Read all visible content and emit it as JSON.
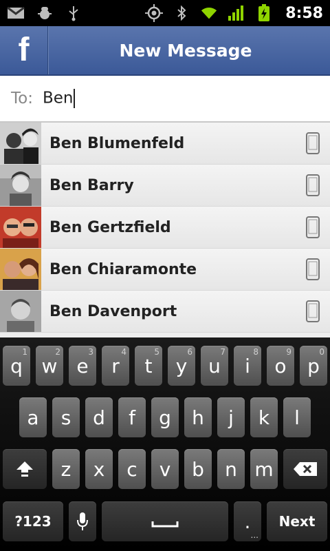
{
  "status_bar": {
    "time": "8:58",
    "icons_left": [
      "gmail-icon",
      "debug-icon",
      "usb-icon"
    ],
    "icons_right": [
      "gps-icon",
      "bluetooth-icon",
      "wifi-icon",
      "signal-icon",
      "battery-charging-icon"
    ]
  },
  "header": {
    "logo": "f",
    "title": "New Message"
  },
  "to_field": {
    "label": "To:",
    "value": "Ben"
  },
  "contacts": [
    {
      "name": "Ben Blumenfeld"
    },
    {
      "name": "Ben Barry"
    },
    {
      "name": "Ben Gertzfield"
    },
    {
      "name": "Ben Chiaramonte"
    },
    {
      "name": "Ben Davenport"
    }
  ],
  "keyboard": {
    "row1": [
      {
        "label": "q",
        "hint": "1"
      },
      {
        "label": "w",
        "hint": "2"
      },
      {
        "label": "e",
        "hint": "3"
      },
      {
        "label": "r",
        "hint": "4"
      },
      {
        "label": "t",
        "hint": "5"
      },
      {
        "label": "y",
        "hint": "6"
      },
      {
        "label": "u",
        "hint": "7"
      },
      {
        "label": "i",
        "hint": "8"
      },
      {
        "label": "o",
        "hint": "9"
      },
      {
        "label": "p",
        "hint": "0"
      }
    ],
    "row2": [
      "a",
      "s",
      "d",
      "f",
      "g",
      "h",
      "j",
      "k",
      "l"
    ],
    "row3": [
      "z",
      "x",
      "c",
      "v",
      "b",
      "n",
      "m"
    ],
    "symbols_label": "?123",
    "period_label": ".",
    "period_hint": "...",
    "next_label": "Next"
  }
}
